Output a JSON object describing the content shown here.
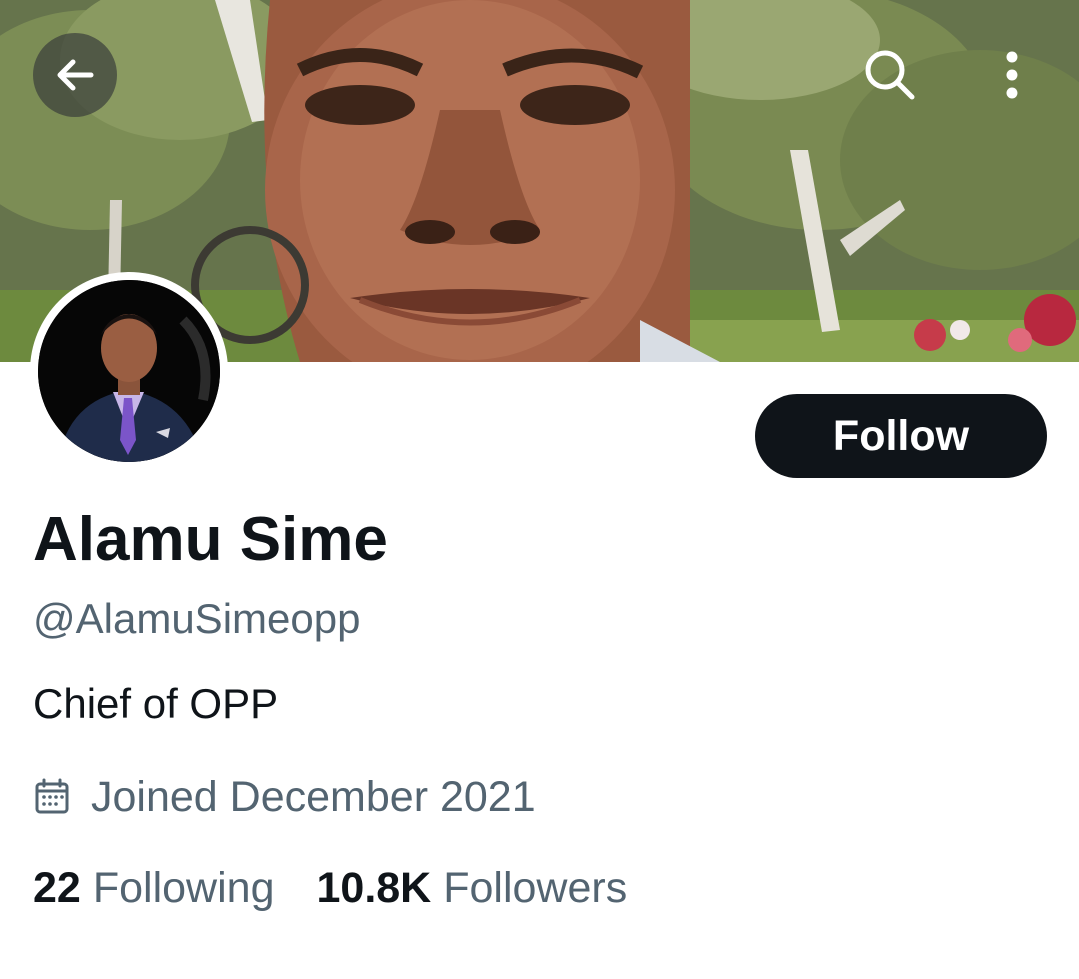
{
  "header": {
    "back_icon": "arrow-left-icon",
    "search_icon": "search-icon",
    "more_icon": "more-vertical-icon"
  },
  "profile": {
    "display_name": "Alamu Sime",
    "handle": "@AlamuSimeopp",
    "bio": "Chief of OPP",
    "joined_icon": "calendar-icon",
    "joined": "Joined December 2021",
    "follow_label": "Follow"
  },
  "stats": {
    "following_count": "22",
    "following_label": "Following",
    "followers_count": "10.8K",
    "followers_label": "Followers"
  },
  "colors": {
    "primary_text": "#0f1419",
    "secondary_text": "#536471",
    "follow_button_bg": "#0f1419",
    "follow_button_text": "#ffffff",
    "background": "#ffffff"
  }
}
